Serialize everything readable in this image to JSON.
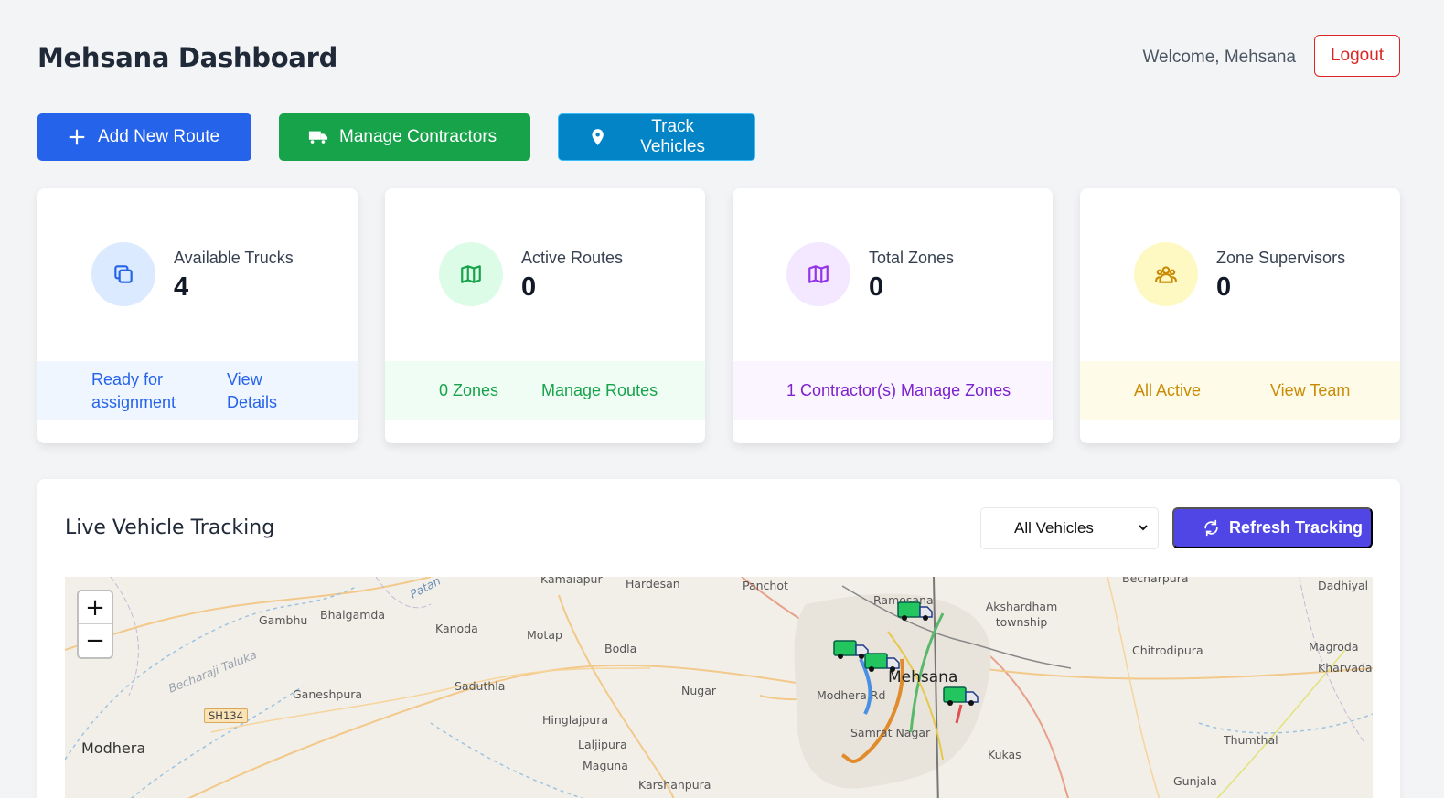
{
  "header": {
    "title": "Mehsana Dashboard",
    "welcome": "Welcome, Mehsana",
    "logout_label": "Logout"
  },
  "actions": {
    "add_route": "Add New Route",
    "manage_contractors": "Manage Contractors",
    "track_vehicles": "Track Vehicles"
  },
  "stats": [
    {
      "label": "Available Trucks",
      "value": "4",
      "footer_left": "Ready for assignment",
      "footer_right": "View Details"
    },
    {
      "label": "Active Routes",
      "value": "0",
      "footer_left": "0 Zones",
      "footer_right": "Manage Routes"
    },
    {
      "label": "Total Zones",
      "value": "0",
      "footer_left": "1 Contractor(s)",
      "footer_right": "Manage Zones"
    },
    {
      "label": "Zone Supervisors",
      "value": "0",
      "footer_left": "All Active",
      "footer_right": "View Team"
    }
  ],
  "tracking": {
    "title": "Live Vehicle Tracking",
    "filter_selected": "All Vehicles",
    "refresh_label": "Refresh Tracking"
  },
  "map": {
    "zoom_in": "+",
    "zoom_out": "−",
    "places": [
      "Kamalapur",
      "Hardesan",
      "Panchot",
      "Becharpura",
      "Dadhiyal",
      "Patan",
      "Gambhu",
      "Bhalgamda",
      "Kanoda",
      "Motap",
      "Bodla",
      "Ramosana",
      "Akshardham township",
      "Chitrodipura",
      "Magroda",
      "Kharvada",
      "Becharaji Taluka",
      "Saduthla",
      "Ganeshpura",
      "Nugar",
      "Mehsana",
      "Modhera Rd",
      "SH134",
      "Hinglajpura",
      "Laljipura",
      "Maguna",
      "Samrat Nagar",
      "Kukas",
      "Thumthal",
      "Modhera",
      "Karshanpura",
      "Gunjala"
    ]
  },
  "colors": {
    "primary_blue": "#2563eb",
    "green": "#16a34a",
    "sky": "#0284c7",
    "indigo": "#4f46e5",
    "logout_red": "#dc2626"
  }
}
